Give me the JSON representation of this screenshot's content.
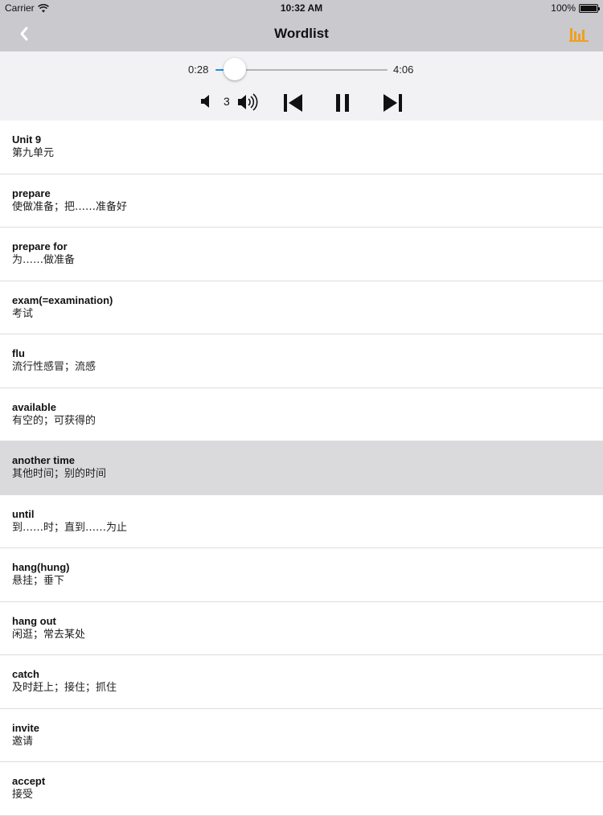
{
  "status_bar": {
    "carrier": "Carrier",
    "time": "10:32 AM",
    "battery": "100%"
  },
  "nav": {
    "title": "Wordlist",
    "back_icon": "chevron-left-icon",
    "right_icon": "bar-chart-icon",
    "accent_color": "#f0a020"
  },
  "player": {
    "current_time": "0:28",
    "total_time": "4:06",
    "progress": 0.114,
    "volume_level": "3",
    "accent_color": "#1a8fe3"
  },
  "words": [
    {
      "word": "Unit 9",
      "meaning": "第九单元"
    },
    {
      "word": "prepare",
      "meaning": "使做准备；把……准备好"
    },
    {
      "word": "prepare for",
      "meaning": "为……做准备"
    },
    {
      "word": "exam(=examination)",
      "meaning": "考试"
    },
    {
      "word": "flu",
      "meaning": "流行性感冒；流感"
    },
    {
      "word": "available",
      "meaning": "有空的；可获得的"
    },
    {
      "word": "another time",
      "meaning": "其他时间；别的时间",
      "selected": true
    },
    {
      "word": "until",
      "meaning": "到……时；直到……为止"
    },
    {
      "word": "hang(hung)",
      "meaning": "悬挂；垂下"
    },
    {
      "word": "hang out",
      "meaning": "闲逛；常去某处"
    },
    {
      "word": "catch",
      "meaning": "及时赶上；接住；抓住"
    },
    {
      "word": "invite",
      "meaning": "邀请"
    },
    {
      "word": "accept",
      "meaning": "接受"
    }
  ]
}
